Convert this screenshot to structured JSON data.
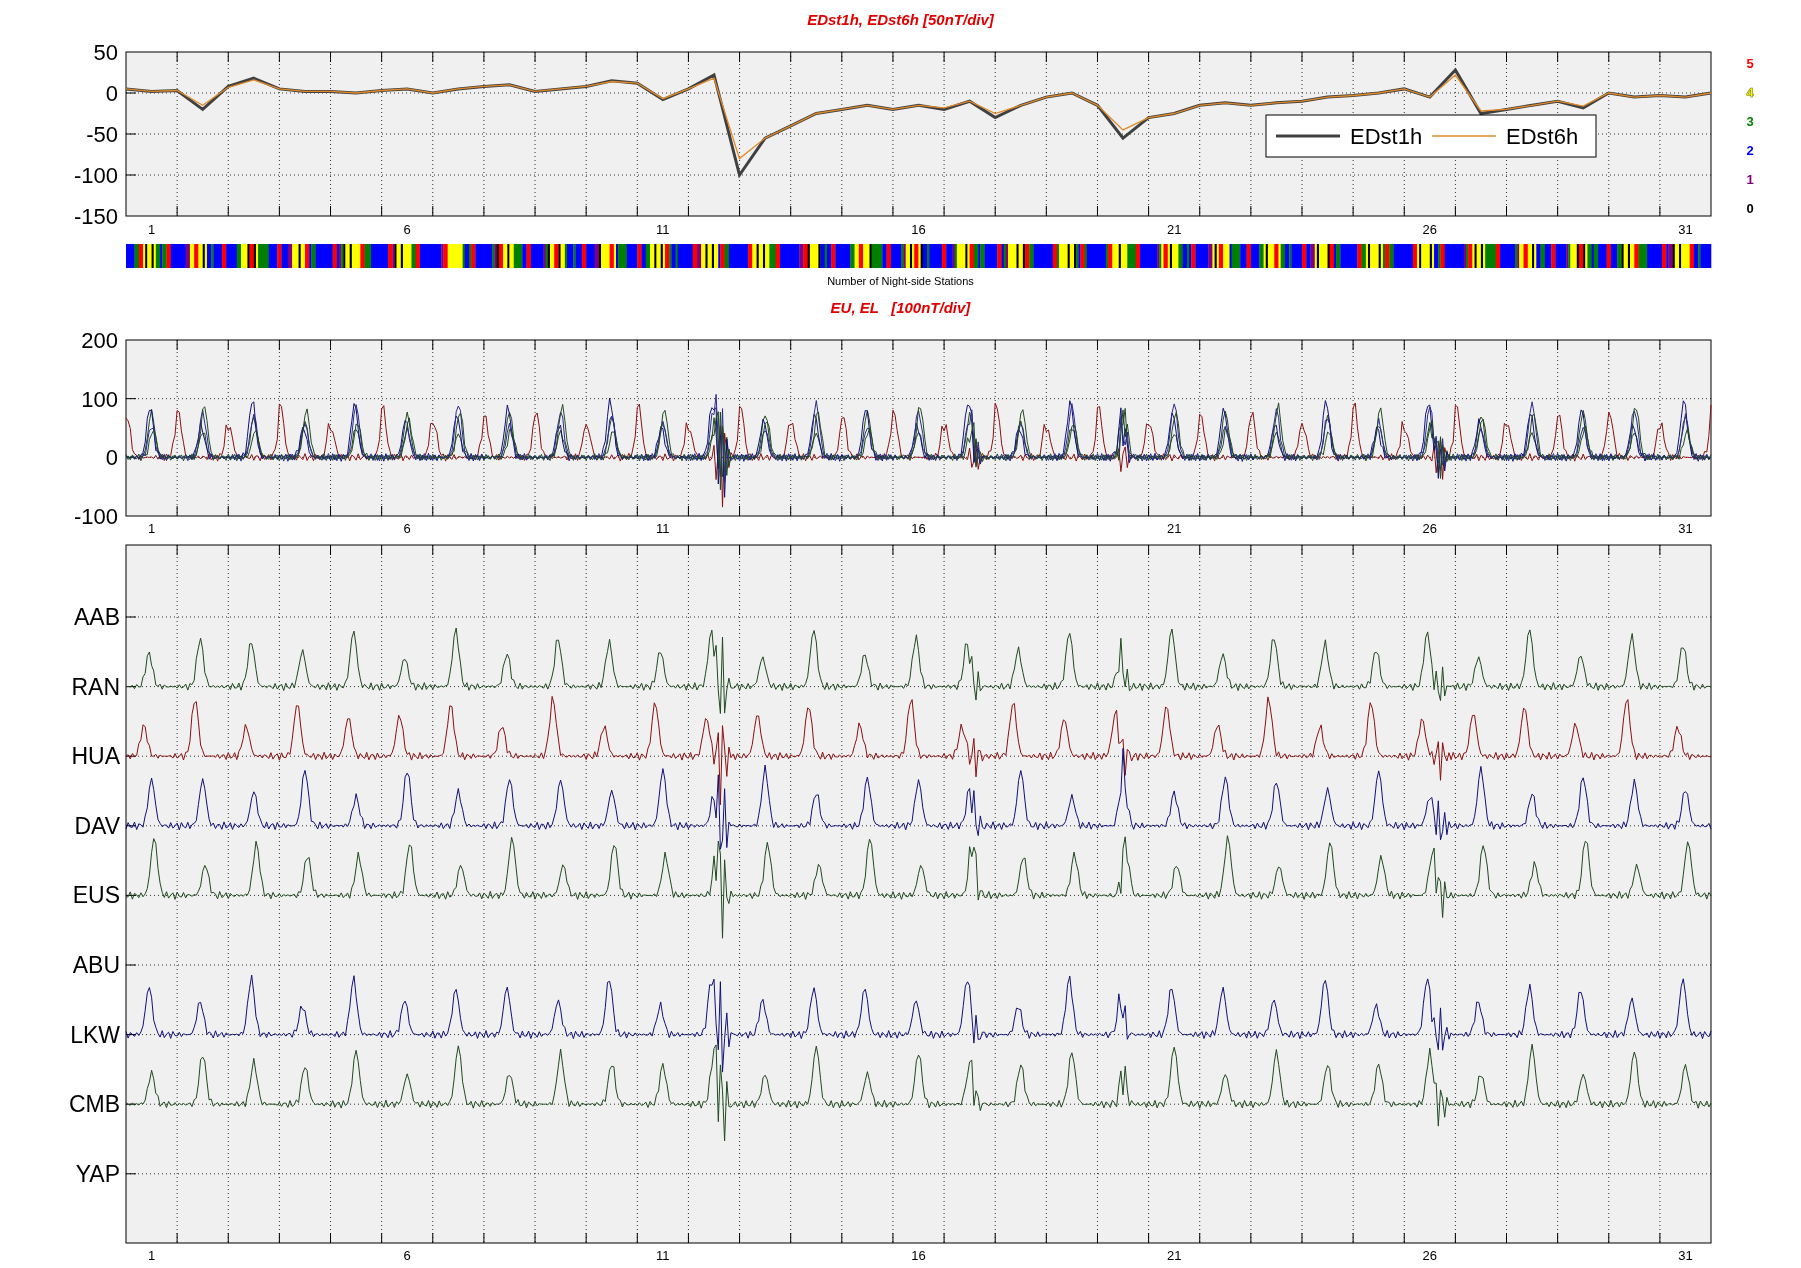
{
  "dst_panel": {
    "chart_data": {
      "type": "line",
      "title": "EDst1h, EDst6h [50nT/div]",
      "x": [
        0.5,
        1,
        1.5,
        2,
        2.5,
        3,
        3.5,
        4,
        4.5,
        5,
        5.5,
        6,
        6.5,
        7,
        7.5,
        8,
        8.5,
        9,
        9.5,
        10,
        10.5,
        11,
        11.5,
        12,
        12.5,
        13,
        13.5,
        14,
        14.5,
        15,
        15.5,
        16,
        16.5,
        17,
        17.5,
        18,
        18.5,
        19,
        19.5,
        20,
        20.5,
        21,
        21.5,
        22,
        22.5,
        23,
        23.5,
        24,
        24.5,
        25,
        25.5,
        26,
        26.5,
        27,
        27.5,
        28,
        28.5,
        29,
        29.5,
        30,
        30.5,
        31,
        31.5
      ],
      "series": [
        {
          "name": "EDst1h",
          "color": "#404040",
          "values": [
            5,
            2,
            3,
            -20,
            8,
            18,
            5,
            2,
            2,
            0,
            3,
            5,
            0,
            5,
            8,
            10,
            2,
            5,
            8,
            15,
            12,
            -8,
            5,
            22,
            -100,
            -55,
            -40,
            -25,
            -20,
            -15,
            -20,
            -15,
            -20,
            -10,
            -30,
            -15,
            -5,
            0,
            -15,
            -55,
            -30,
            -25,
            -15,
            -12,
            -15,
            -12,
            -10,
            -5,
            -3,
            0,
            5,
            -5,
            28,
            -25,
            -20,
            -15,
            -10,
            -18,
            0,
            -5,
            -3,
            -5,
            0
          ]
        },
        {
          "name": "EDst6h",
          "color": "#e08a2a",
          "values": [
            5,
            2,
            3,
            -15,
            7,
            16,
            5,
            2,
            2,
            0,
            3,
            5,
            0,
            5,
            8,
            10,
            2,
            5,
            8,
            14,
            12,
            -7,
            5,
            18,
            -80,
            -55,
            -40,
            -25,
            -20,
            -15,
            -20,
            -15,
            -18,
            -10,
            -25,
            -15,
            -5,
            0,
            -15,
            -45,
            -30,
            -25,
            -15,
            -12,
            -15,
            -12,
            -10,
            -5,
            -3,
            0,
            5,
            -5,
            22,
            -22,
            -20,
            -15,
            -10,
            -16,
            0,
            -5,
            -3,
            -5,
            0
          ]
        }
      ],
      "xlim": [
        0.5,
        31.5
      ],
      "ylim": [
        -150,
        50
      ],
      "xticks": [
        {
          "value": 1,
          "label": "1"
        },
        {
          "value": 6,
          "label": "6"
        },
        {
          "value": 11,
          "label": "11"
        },
        {
          "value": 16,
          "label": "16"
        },
        {
          "value": 21,
          "label": "21"
        },
        {
          "value": 26,
          "label": "26"
        },
        {
          "value": 31,
          "label": "31"
        }
      ],
      "yticks": [
        50,
        0,
        -50,
        -100,
        -150
      ],
      "grid": true,
      "legend": true
    }
  },
  "station_count_scale": [
    {
      "label": "5",
      "color": "#ff0000"
    },
    {
      "label": "4",
      "color": "#ffff00"
    },
    {
      "label": "3",
      "color": "#008000"
    },
    {
      "label": "2",
      "color": "#0000ff"
    },
    {
      "label": "1",
      "color": "#800080"
    },
    {
      "label": "0",
      "color": "#000000"
    }
  ],
  "colorbar": {
    "caption": "Number of Night-side Stations"
  },
  "eu_panel": {
    "title": "EU, EL   [100nT/div]",
    "yticks": [
      "200",
      "100",
      "0",
      "-100"
    ],
    "xticks": [
      "1",
      "6",
      "11",
      "16",
      "21",
      "26",
      "31"
    ]
  },
  "stations_panel": {
    "stations": [
      "AAB",
      "RAN",
      "HUA",
      "DAV",
      "EUS",
      "ABU",
      "LKW",
      "CMB",
      "YAP"
    ],
    "xticks": [
      "1",
      "6",
      "11",
      "16",
      "21",
      "26",
      "31"
    ]
  }
}
